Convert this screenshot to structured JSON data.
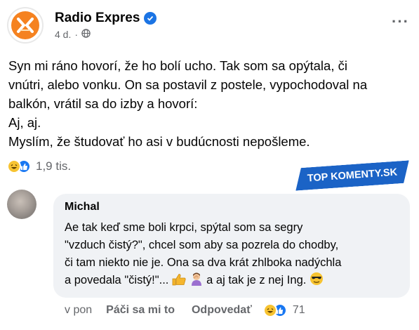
{
  "post": {
    "page_name": "Radio Expres",
    "time": "4 d.",
    "separator": "·",
    "more": "···",
    "lines": [
      "Syn mi ráno hovorí, že ho bolí ucho. Tak som sa opýtala, či",
      "vnútri, alebo vonku. On sa postavil z postele, vypochodoval na",
      "balkón, vrátil sa do izby a hovorí:",
      "Aj, aj.",
      "Myslím, že študovať ho asi v budúcnosti nepošleme."
    ],
    "reaction_count": "1,9 tis."
  },
  "watermark": "TOP KOMENTY.SK",
  "comment": {
    "author": "Michal",
    "lines": [
      "Ae tak keď sme boli krpci, spýtal som sa segry",
      "\"vzduch čistý?\", chcel som aby sa pozrela do chodby,",
      "či tam niekto nie je. Ona sa dva krát zhlboka nadýchla"
    ],
    "last_line_start": "a povedala \"čistý!\"...",
    "last_line_end": "a aj tak je z nej Ing.",
    "time": "v pon",
    "like_action": "Páči sa mi to",
    "reply_action": "Odpovedať",
    "reaction_count": "71"
  },
  "colors": {
    "brand": "#f58220",
    "verified": "#1b74e4",
    "like": "#1877f2",
    "haha": "#f7c331",
    "watermark": "#1b63c6"
  }
}
